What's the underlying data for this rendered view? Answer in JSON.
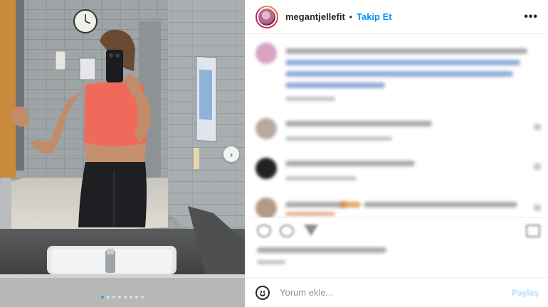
{
  "post": {
    "username": "megantjellefit",
    "separator": "•",
    "follow_label": "Takip Et",
    "more_label": "•••"
  },
  "carousel": {
    "next_label": "›",
    "total_slides": 8,
    "active_slide": 1
  },
  "comment_box": {
    "placeholder": "Yorum ekle...",
    "post_label": "Paylaş"
  },
  "colors": {
    "link": "#0095f6",
    "post_disabled": "#b2dffc",
    "dot_active": "#2f9df7"
  }
}
